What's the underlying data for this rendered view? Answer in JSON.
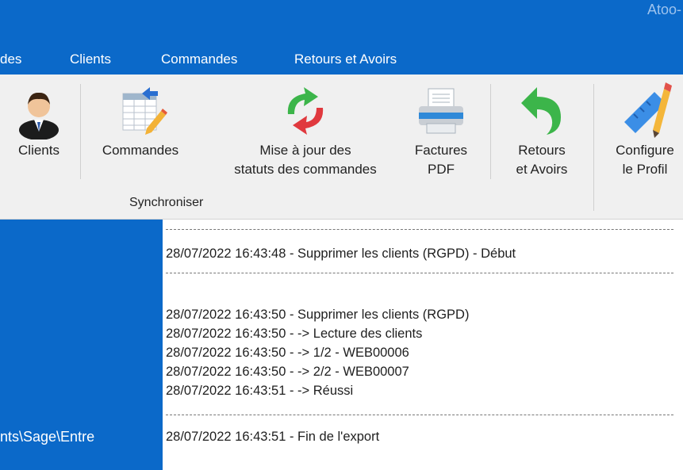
{
  "window": {
    "title": "Atoo-"
  },
  "menu": {
    "items": [
      {
        "label": "des"
      },
      {
        "label": "Clients"
      },
      {
        "label": "Commandes"
      },
      {
        "label": "Retours et Avoirs"
      }
    ]
  },
  "ribbon": {
    "buttons": [
      {
        "label": "Clients",
        "icon": "person-icon"
      },
      {
        "label": "Commandes",
        "icon": "order-sheet-icon"
      },
      {
        "label_line1": "Mise à jour des",
        "label_line2": "statuts des commandes",
        "icon": "sync-arrows-icon"
      },
      {
        "label_line1": "Factures",
        "label_line2": "PDF",
        "icon": "printer-icon"
      },
      {
        "label_line1": "Retours",
        "label_line2": "et Avoirs",
        "icon": "return-arrow-icon"
      },
      {
        "label_line1": "Configure",
        "label_line2": "le Profil",
        "icon": "pencil-ruler-icon"
      }
    ],
    "group_label": "Synchroniser"
  },
  "left_panel": {
    "path": "nts\\Sage\\Entre"
  },
  "log": {
    "lines": [
      "28/07/2022 16:43:48 - Supprimer les clients (RGPD) - Début",
      "28/07/2022 16:43:50 - Supprimer les clients (RGPD)",
      "28/07/2022 16:43:50 - -> Lecture des clients",
      "28/07/2022 16:43:50 - -> 1/2 - WEB00006",
      "28/07/2022 16:43:50 - -> 2/2 - WEB00007",
      "28/07/2022 16:43:51 - -> Réussi",
      "28/07/2022 16:43:51 - Fin de l'export"
    ]
  },
  "colors": {
    "accent": "#0b69c9",
    "ribbon_bg": "#f0f0f0"
  }
}
